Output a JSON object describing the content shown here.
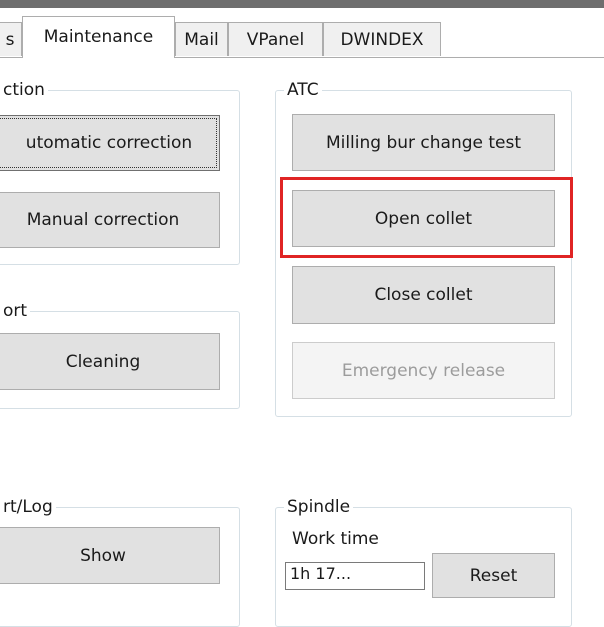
{
  "tabs": {
    "partial_left": "s",
    "maintenance": "Maintenance",
    "mail": "Mail",
    "vpanel": "VPanel",
    "dwindex": "DWINDEX"
  },
  "correction_group": {
    "title": "ction",
    "automatic_button": "utomatic correction",
    "manual_button": "Manual correction"
  },
  "support_group": {
    "title": "ort",
    "cleaning_button": "Cleaning"
  },
  "log_group": {
    "title": "rt/Log",
    "show_button": "Show"
  },
  "atc_group": {
    "title": "ATC",
    "milling_bur_button": "Milling bur change test",
    "open_collet_button": "Open collet",
    "close_collet_button": "Close collet",
    "emergency_release_button": "Emergency release"
  },
  "spindle_group": {
    "title": "Spindle",
    "work_time_label": "Work time",
    "work_time_value": "1h 17...",
    "reset_button": "Reset"
  }
}
